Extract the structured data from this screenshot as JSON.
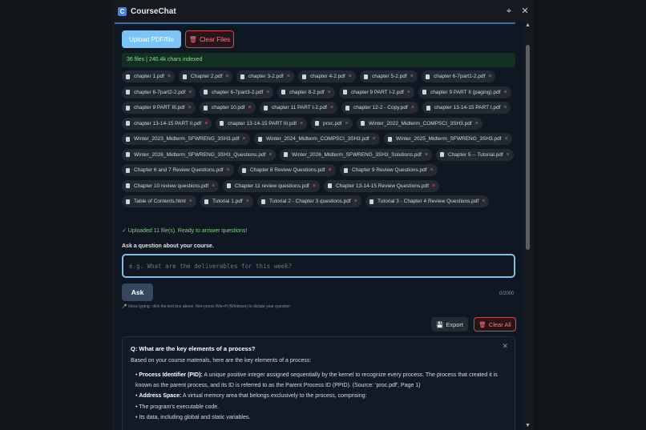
{
  "window": {
    "title": "CourseChat",
    "icon": "app-icon"
  },
  "toolbar": {
    "upload_label": "Upload PDF/file",
    "clear_files_label": "Clear Files"
  },
  "status": {
    "indexed_text": "36 files | 240.4k chars indexed"
  },
  "files": [
    "chapter 1.pdf",
    "Chapter 2.pdf",
    "chapter 3-2.pdf",
    "chapter 4-2.pdf",
    "chapter 5-2.pdf",
    "chapter 6-7part1-2.pdf",
    "chapter 6-7part2-2.pdf",
    "chapter 6-7part3-2.pdf",
    "chapter 8-2.pdf",
    "chapter 9 PART I-2.pdf",
    "chapter 9 PART II (paging).pdf",
    "chapter 9 PART III.pdf",
    "chapter 10.pdf",
    "chapter 11 PART I-2.pdf",
    "chapter 12-2 - Copy.pdf",
    "chapter 13-14-15 PART I.pdf",
    "chapter 13-14-15 PART II.pdf",
    "chapter 13-14-15 PART III.pdf",
    "proc.pdf",
    "Winter_2022_Midterm_COMPSCI_3SH3.pdf",
    "Winter_2023_Midterm_SFWRENG_3SH3.pdf",
    "Winter_2024_Midterm_COMPSCI_3SH3.pdf",
    "Winter_2025_Midterm_SFWRENG_3SH3.pdf",
    "Winter_2026_Midterm_SFWRENG_3SH3_Questions.pdf",
    "Winter_2026_Midterm_SFWRENG_3SH3_Solutions.pdf",
    "Chapter 5 -- Tutorial.pdf",
    "Chapter 6 and 7 Review Questions.pdf",
    "Chapter 8 Review Questions.pdf",
    "Chapter 9 Review Questions.pdf",
    "Chapter 10 review questions.pdf",
    "Chapter 11 review questions.pdf",
    "Chapter 13-14-15 Review Questions.pdf",
    "Table of Contents.html",
    "Tutorial 1.pdf",
    "Tutorial 2 - Chapter 3 questions.pdf",
    "Tutorial 3 - Chapter 4 Review Questions.pdf"
  ],
  "upload_status": "✓ Uploaded 11 file(s). Ready to answer questions!",
  "ask": {
    "label": "Ask a question about your course.",
    "placeholder": "e.g. What are the deliverables for this week?",
    "button": "Ask",
    "char_count": "0/2000",
    "voice_hint": "Voice typing: click the text box above, then press Win+H (Windows) to dictate your question"
  },
  "actions": {
    "export_label": "Export",
    "clear_all_label": "Clear All"
  },
  "answer": {
    "question": "Q: What are the key elements of a process?",
    "intro": "Based on your course materials, here are the key elements of a process:",
    "bullets": [
      {
        "term": "Process Identifier (PID):",
        "text": " A unique positive integer assigned sequentially by the kernel to recognize every process. The process that created it is known as the parent process, and its ID is referred to as the Parent Process ID (PPID). (Source: 'proc.pdf', Page 1)"
      },
      {
        "term": "Address Space:",
        "text": " A virtual memory area that belongs exclusively to the process, comprising:"
      },
      {
        "term": "",
        "text": "The program's executable code."
      },
      {
        "term": "",
        "text": "Its data, including global and static variables."
      }
    ]
  }
}
